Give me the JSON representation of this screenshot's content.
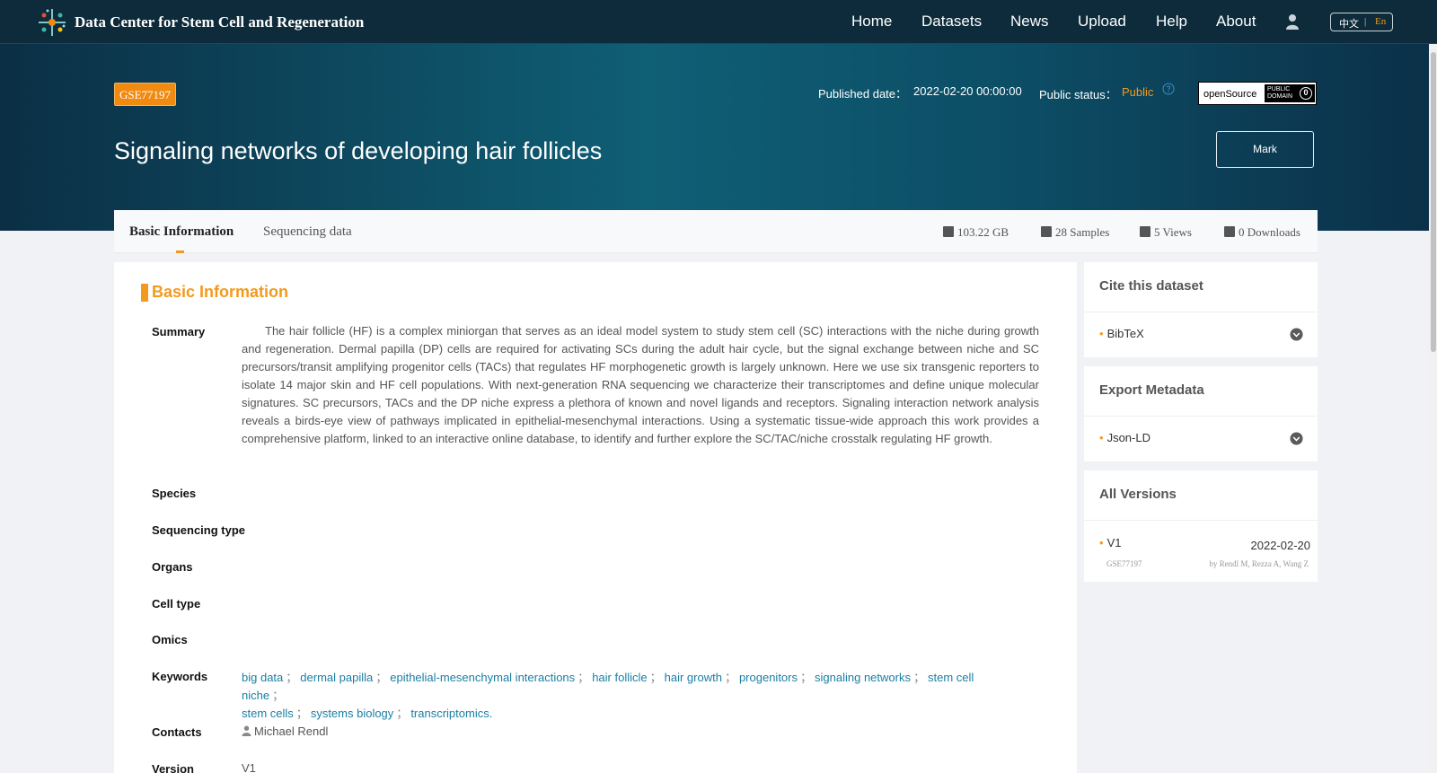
{
  "header": {
    "brand": "Data Center for Stem Cell and Regeneration",
    "nav": [
      "Home",
      "Datasets",
      "News",
      "Upload",
      "Help",
      "About"
    ],
    "lang_zh": "中文",
    "lang_sep": "|",
    "lang_en": "En"
  },
  "hero": {
    "accession": "GSE77197",
    "published_label": "Published date：",
    "published_value": "2022-02-20 00:00:00",
    "status_label": "Public status：",
    "status_value": "Public",
    "open_source": "openSource",
    "public_domain_line1": "PUBLIC",
    "public_domain_line2": "DOMAIN",
    "public_domain_mark": "0",
    "title": "Signaling networks of developing hair follicles",
    "mark_label": "Mark"
  },
  "tabs": {
    "basic": "Basic Information",
    "sequencing": "Sequencing data",
    "size": "103.22 GB",
    "samples": "28 Samples",
    "views": "5 Views",
    "downloads": "0 Downloads"
  },
  "basic": {
    "section_title": "Basic Information",
    "labels": {
      "summary": "Summary",
      "species": "Species",
      "sequencing_type": "Sequencing type",
      "organs": "Organs",
      "cell_type": "Cell type",
      "omics": "Omics",
      "keywords": "Keywords",
      "contacts": "Contacts",
      "version": "Version"
    },
    "summary": "The hair follicle (HF) is a complex miniorgan that serves as an ideal model system to study stem cell (SC) interactions with the niche during growth and regeneration. Dermal papilla (DP) cells are required for activating SCs during the adult hair cycle, but the signal exchange between niche and SC precursors/transit amplifying progenitor cells (TACs) that regulates HF morphogenetic growth is largely unknown. Here we use six transgenic reporters to isolate 14 major skin and HF cell populations. With next-generation RNA sequencing we characterize their transcriptomes and define unique molecular signatures. SC precursors, TACs and the DP niche express a plethora of known and novel ligands and receptors. Signaling interaction network analysis reveals a birds-eye view of pathways implicated in epithelial-mesenchymal interactions. Using a systematic tissue-wide approach this work provides a comprehensive platform, linked to an interactive online database, to identify and further explore the SC/TAC/niche crosstalk regulating HF growth.",
    "keyword_separator": "；",
    "keywords": [
      "big data",
      "dermal papilla",
      "epithelial-mesenchymal interactions",
      "hair follicle",
      "hair growth",
      "progenitors",
      "signaling networks",
      "stem cell niche",
      "stem cells",
      "systems biology",
      "transcriptomics."
    ],
    "contact": "Michael Rendl",
    "version": "V1"
  },
  "side": {
    "cite_title": "Cite this dataset",
    "cite_item": "BibTeX",
    "export_title": "Export Metadata",
    "export_item": "Json-LD",
    "versions_title": "All Versions",
    "bullet": "•",
    "versions": [
      {
        "name": "V1",
        "date": "2022-02-20",
        "accession": "GSE77197",
        "authors": "by Rendl M, Rezza A, Wang Z"
      }
    ]
  },
  "colors": {
    "header_bg": "#0d2b3a",
    "accent_orange": "#f39a1e",
    "link_teal": "#1a7fa4"
  }
}
